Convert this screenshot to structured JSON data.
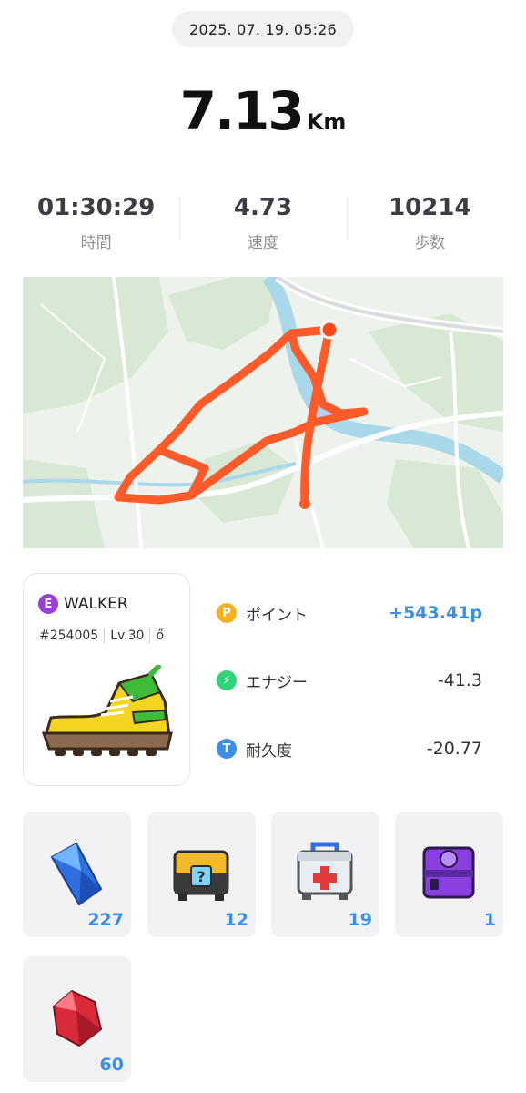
{
  "header": {
    "datetime": "2025. 07. 19. 05:26"
  },
  "distance": {
    "value": "7.13",
    "unit": "Km"
  },
  "stats": [
    {
      "value": "01:30:29",
      "label": "時間"
    },
    {
      "value": "4.73",
      "label": "速度"
    },
    {
      "value": "10214",
      "label": "歩数"
    }
  ],
  "map": {
    "route_color": "#ff5a2a"
  },
  "walker": {
    "badge": "E",
    "name": "WALKER",
    "id": "#254005",
    "level": "Lv.30",
    "extra_glyph": "ő"
  },
  "metrics": [
    {
      "icon_text": "P",
      "icon_color": "#f5b21e",
      "label": "ポイント",
      "value": "+543.41p"
    },
    {
      "icon_text": "⚡",
      "icon_color": "#2fd47a",
      "label": "エナジー",
      "value": "-41.3"
    },
    {
      "icon_text": "T",
      "icon_color": "#3b8fe8",
      "label": "耐久度",
      "value": "-20.77"
    }
  ],
  "items": [
    {
      "icon": "blue-crystal-icon",
      "count": "227"
    },
    {
      "icon": "mystery-box-icon",
      "count": "12"
    },
    {
      "icon": "first-aid-kit-icon",
      "count": "19"
    },
    {
      "icon": "purple-box-icon",
      "count": "1"
    },
    {
      "icon": "red-gem-icon",
      "count": "60"
    }
  ],
  "colors": {
    "accent_blue": "#3b8fe8",
    "route": "#ff5a2a"
  }
}
